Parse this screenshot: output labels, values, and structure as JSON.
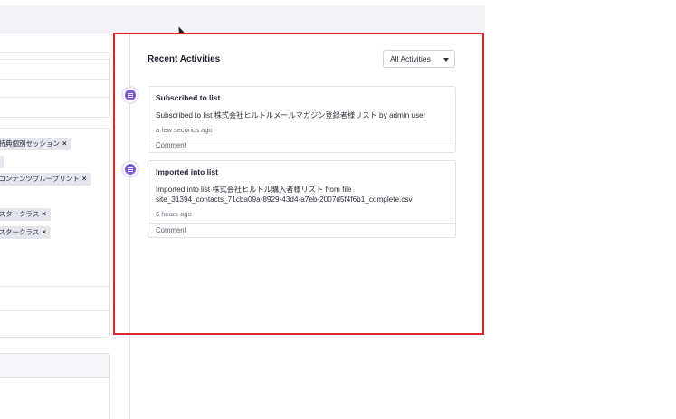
{
  "left_panel": {
    "tags": [
      {
        "label": "会特典個別セッション",
        "remove": "×"
      },
      {
        "label": "",
        "remove": "×"
      },
      {
        "label": "ルコンテンツブループリント",
        "remove": "×"
      },
      {
        "label": "マスタークラス",
        "remove": "×"
      },
      {
        "label": "マスタークラス",
        "remove": "×"
      }
    ]
  },
  "activities": {
    "title": "Recent Activities",
    "filter": {
      "selected": "All Activities"
    },
    "items": [
      {
        "title": "Subscribed to list",
        "body": "Subscribed to list 株式会社ヒルトルメールマガジン登録者様リスト by admin user",
        "time": "a few seconds ago",
        "comment_label": "Comment"
      },
      {
        "title": "Imported into list",
        "body": "Imported into list 株式会社ヒルトル購入者様リスト from file site_31394_contacts_71cba09a-8929-43d4-a7eb-2007d5f4f6b1_complete.csv",
        "time": "6 hours ago",
        "comment_label": "Comment"
      }
    ]
  },
  "colors": {
    "highlight": "#e0242e",
    "timeline_icon": "#7b58d6"
  }
}
